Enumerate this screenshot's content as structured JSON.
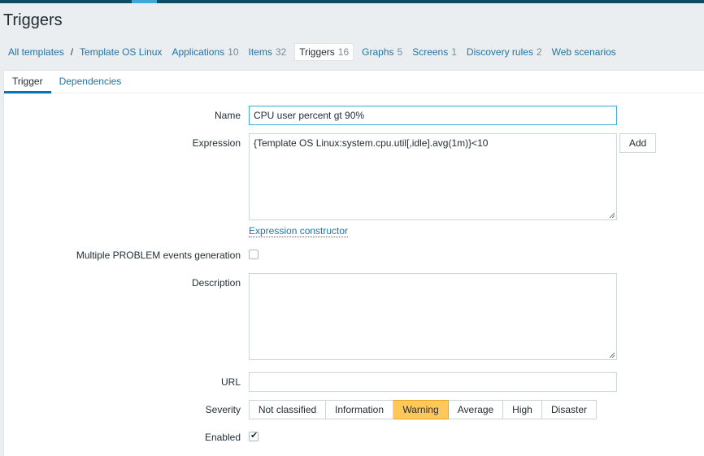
{
  "page": {
    "title": "Triggers"
  },
  "breadcrumbs": {
    "all_templates": "All templates",
    "separator": "/",
    "template": "Template OS Linux",
    "items": [
      {
        "label": "Applications",
        "count": "10"
      },
      {
        "label": "Items",
        "count": "32"
      },
      {
        "label": "Triggers",
        "count": "16"
      },
      {
        "label": "Graphs",
        "count": "5"
      },
      {
        "label": "Screens",
        "count": "1"
      },
      {
        "label": "Discovery rules",
        "count": "2"
      },
      {
        "label": "Web scenarios",
        "count": ""
      }
    ]
  },
  "tabs": {
    "trigger": "Trigger",
    "dependencies": "Dependencies"
  },
  "form": {
    "name_label": "Name",
    "name_value": "CPU user percent gt 90%",
    "expression_label": "Expression",
    "expression_value": "{Template OS Linux:system.cpu.util[,idle].avg(1m)}<10",
    "add_button": "Add",
    "expression_constructor": "Expression constructor",
    "multiple_problem_label": "Multiple PROBLEM events generation",
    "multiple_problem_checked": false,
    "description_label": "Description",
    "description_value": "",
    "url_label": "URL",
    "url_value": "",
    "severity_label": "Severity",
    "severity_options": [
      "Not classified",
      "Information",
      "Warning",
      "Average",
      "High",
      "Disaster"
    ],
    "severity_selected": "Warning",
    "enabled_label": "Enabled",
    "enabled_checked": true,
    "checkmark": "✔"
  },
  "colors": {
    "accent": "#0275b8",
    "link": "#1f73a8",
    "warning": "#ffc859",
    "topbar": "#0f4b65"
  }
}
